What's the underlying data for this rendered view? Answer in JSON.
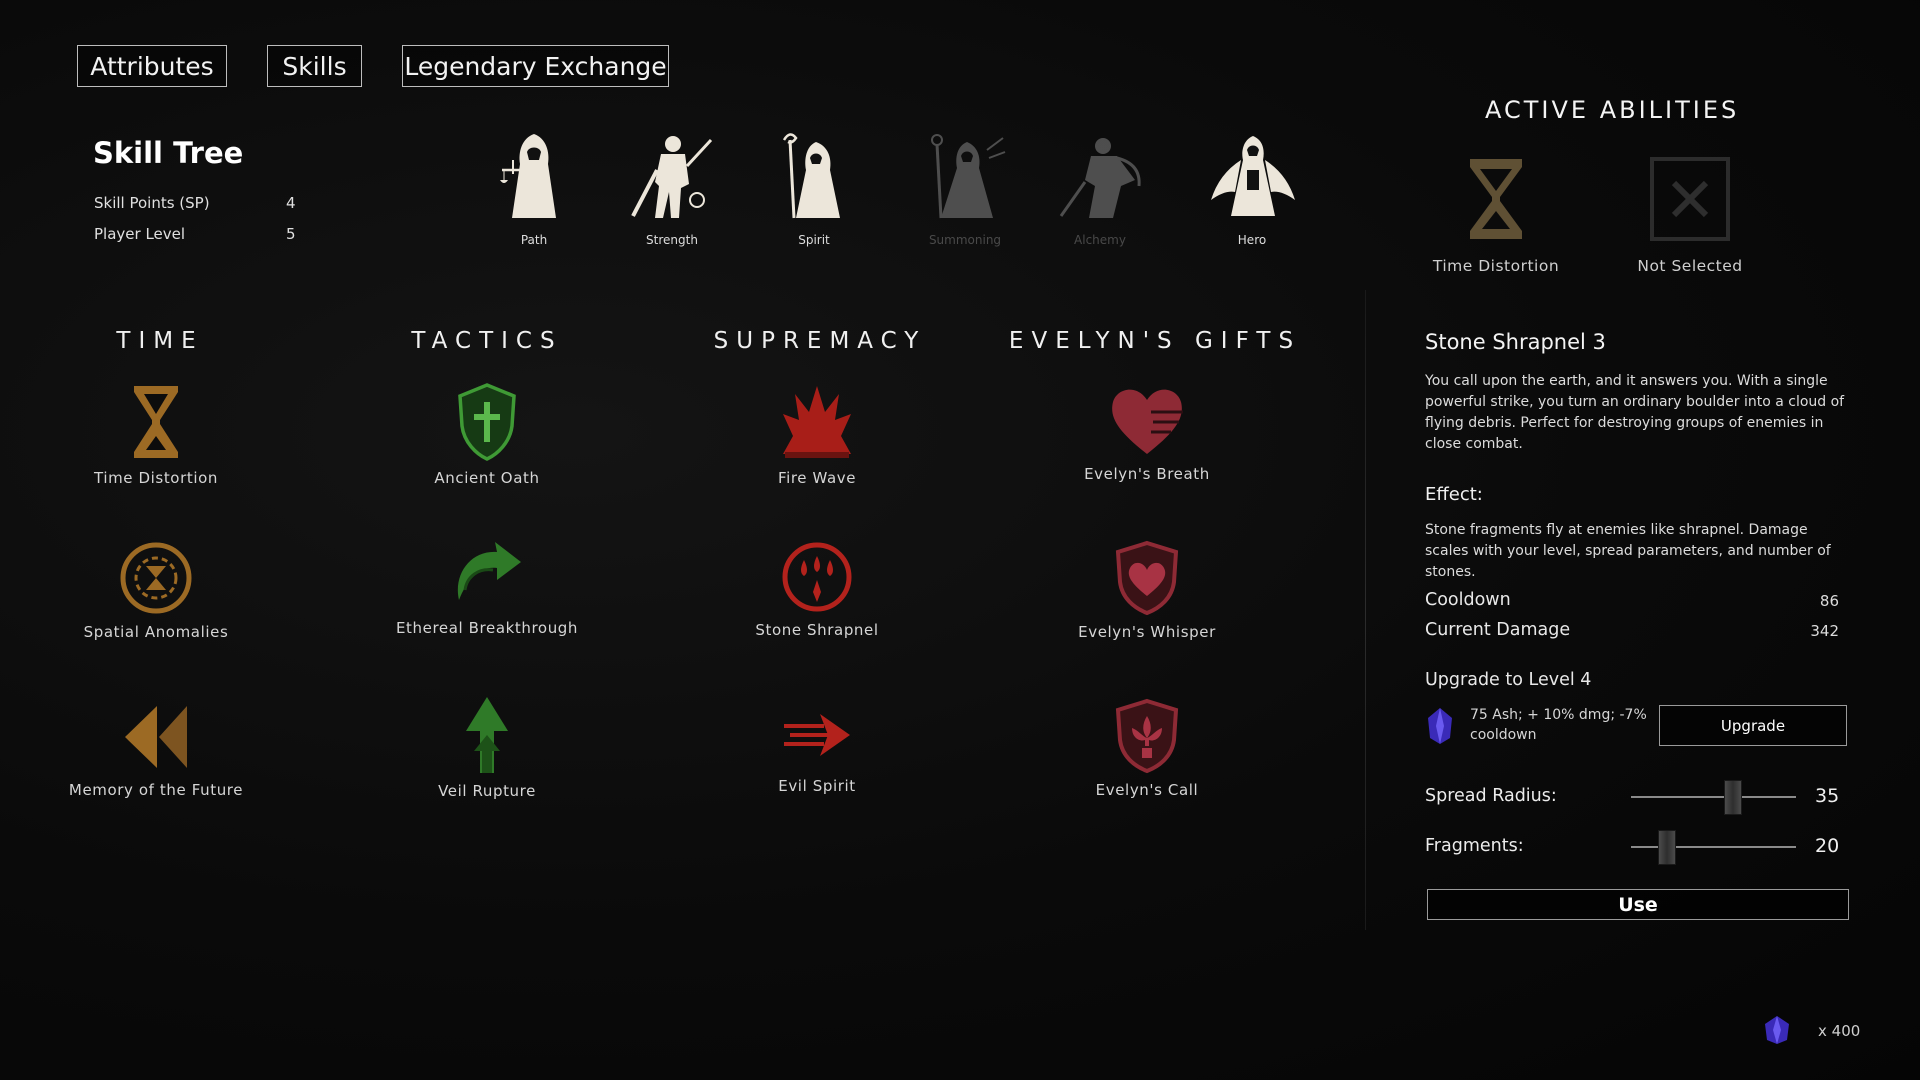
{
  "tabs": [
    {
      "label": "Attributes"
    },
    {
      "label": "Skills"
    },
    {
      "label": "Legendary Exchange"
    }
  ],
  "skill_tree": {
    "title": "Skill Tree",
    "stats": [
      {
        "label": "Skill Points (SP)",
        "value": "4"
      },
      {
        "label": "Player Level",
        "value": "5"
      }
    ]
  },
  "classes": [
    {
      "label": "Path",
      "enabled": true
    },
    {
      "label": "Strength",
      "enabled": true
    },
    {
      "label": "Spirit",
      "enabled": true
    },
    {
      "label": "Summoning",
      "enabled": false
    },
    {
      "label": "Alchemy",
      "enabled": false
    },
    {
      "label": "Hero",
      "enabled": true
    }
  ],
  "categories": [
    {
      "title": "TIME",
      "color": "#b07a2a",
      "skills": [
        {
          "label": "Time Distortion",
          "icon": "hourglass-icon"
        },
        {
          "label": "Spatial Anomalies",
          "icon": "anomaly-rune-icon"
        },
        {
          "label": "Memory of the Future",
          "icon": "rewind-icon"
        }
      ]
    },
    {
      "title": "TACTICS",
      "color": "#3f9a35",
      "skills": [
        {
          "label": "Ancient Oath",
          "icon": "cross-shield-icon"
        },
        {
          "label": "Ethereal Breakthrough",
          "icon": "breakthrough-arrow-icon"
        },
        {
          "label": "Veil Rupture",
          "icon": "upward-arrow-icon"
        }
      ]
    },
    {
      "title": "SUPREMACY",
      "color": "#b3221c",
      "skills": [
        {
          "label": "Fire Wave",
          "icon": "flame-burst-icon"
        },
        {
          "label": "Stone Shrapnel",
          "icon": "shrapnel-drops-icon"
        },
        {
          "label": "Evil Spirit",
          "icon": "spirit-dash-icon"
        }
      ]
    },
    {
      "title": "EVELYN'S GIFTS",
      "color": "#8e2a35",
      "skills": [
        {
          "label": "Evelyn's Breath",
          "icon": "heart-icon"
        },
        {
          "label": "Evelyn's Whisper",
          "icon": "heart-shield-icon"
        },
        {
          "label": "Evelyn's Call",
          "icon": "fleur-shield-icon"
        }
      ]
    }
  ],
  "active_abilities": {
    "title": "ACTIVE ABILITIES",
    "slots": [
      {
        "label": "Time Distortion",
        "icon": "hourglass-icon"
      },
      {
        "label": "Not Selected",
        "icon": "empty-slot-icon"
      }
    ]
  },
  "detail": {
    "title": "Stone Shrapnel 3",
    "description": "You call upon the earth, and it answers you. With a single powerful strike, you turn an ordinary boulder into a cloud of flying debris. Perfect for destroying groups of enemies in close combat.",
    "effect_heading": "Effect:",
    "effect": "Stone fragments fly at enemies like shrapnel. Damage scales with your level, spread parameters, and number of stones.",
    "stats": [
      {
        "label": "Cooldown",
        "value": "86"
      },
      {
        "label": "Current Damage",
        "value": "342"
      }
    ],
    "upgrade_heading": "Upgrade to Level 4",
    "upgrade_cost": "75 Ash; + 10% dmg; -7% cooldown",
    "upgrade_button": "Upgrade",
    "sliders": [
      {
        "label": "Spread Radius:",
        "value": "35",
        "level": 0.62
      },
      {
        "label": "Fragments:",
        "value": "20",
        "level": 0.22
      }
    ],
    "use_button": "Use"
  },
  "currency": {
    "label": "x 400",
    "icon": "ash-crystal-icon"
  }
}
